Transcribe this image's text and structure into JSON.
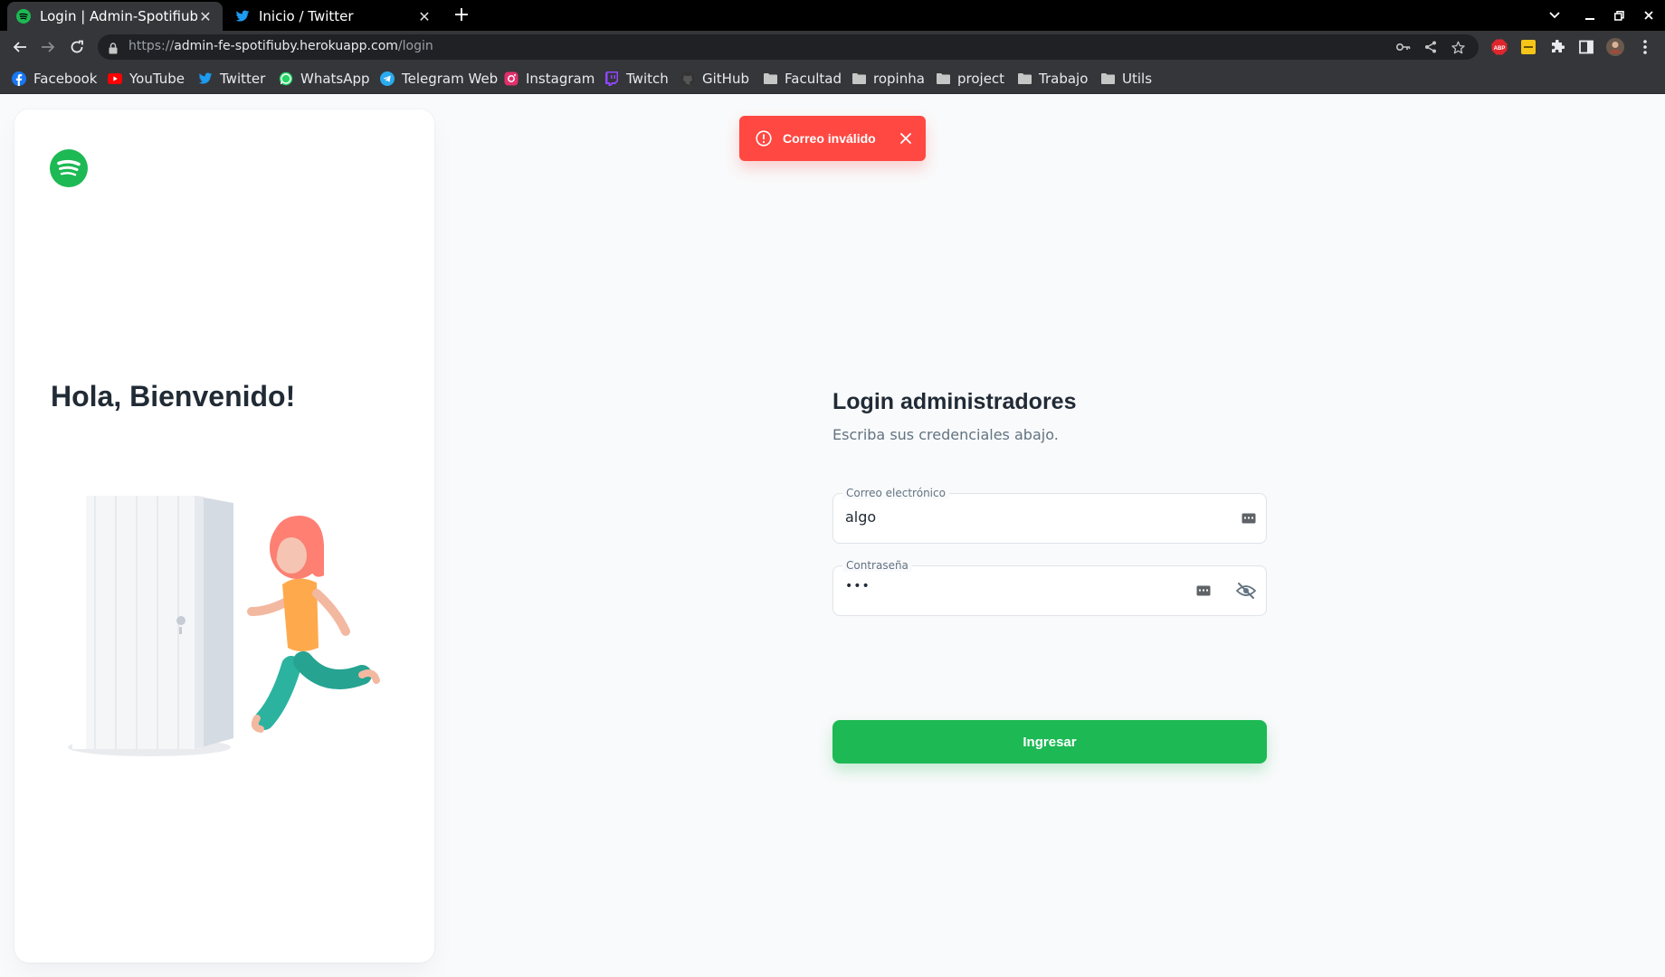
{
  "browser": {
    "tabs": [
      {
        "title": "Login | Admin-Spotifiuby",
        "icon": "spotify-icon",
        "active": true
      },
      {
        "title": "Inicio / Twitter",
        "icon": "twitter-icon",
        "active": false
      }
    ],
    "url_scheme": "https://",
    "url_host": "admin-fe-spotifiuby.herokuapp.com",
    "url_path": "/login",
    "bookmarks": [
      {
        "label": "Facebook",
        "icon": "facebook-icon",
        "color": "#1877f2"
      },
      {
        "label": "YouTube",
        "icon": "youtube-icon",
        "color": "#ff0000"
      },
      {
        "label": "Twitter",
        "icon": "twitter-icon",
        "color": "#1d9bf0"
      },
      {
        "label": "WhatsApp",
        "icon": "whatsapp-icon",
        "color": "#25d366"
      },
      {
        "label": "Telegram Web",
        "icon": "telegram-icon",
        "color": "#2aabee"
      },
      {
        "label": "Instagram",
        "icon": "instagram-icon",
        "color": "#e1306c"
      },
      {
        "label": "Twitch",
        "icon": "twitch-icon",
        "color": "#9146ff"
      },
      {
        "label": "GitHub",
        "icon": "github-icon",
        "color": "#333333"
      },
      {
        "label": "Facultad",
        "icon": "folder-icon"
      },
      {
        "label": "ropinha",
        "icon": "folder-icon"
      },
      {
        "label": "project",
        "icon": "folder-icon"
      },
      {
        "label": "Trabajo",
        "icon": "folder-icon"
      },
      {
        "label": "Utils",
        "icon": "folder-icon"
      }
    ],
    "extensions": [
      "abp-icon",
      "keep-icon",
      "puzzle-icon",
      "sidepanel-icon",
      "profile-avatar",
      "menu-icon"
    ]
  },
  "left_panel": {
    "welcome": "Hola, Bienvenido!"
  },
  "toast": {
    "message": "Correo inválido",
    "color": "#ff4842"
  },
  "login": {
    "title": "Login administradores",
    "subtitle": "Escriba sus credenciales abajo.",
    "email_label": "Correo electrónico",
    "email_value": "algo",
    "password_label": "Contraseña",
    "password_value": "•••",
    "submit_label": "Ingresar",
    "accent": "#1db954"
  }
}
